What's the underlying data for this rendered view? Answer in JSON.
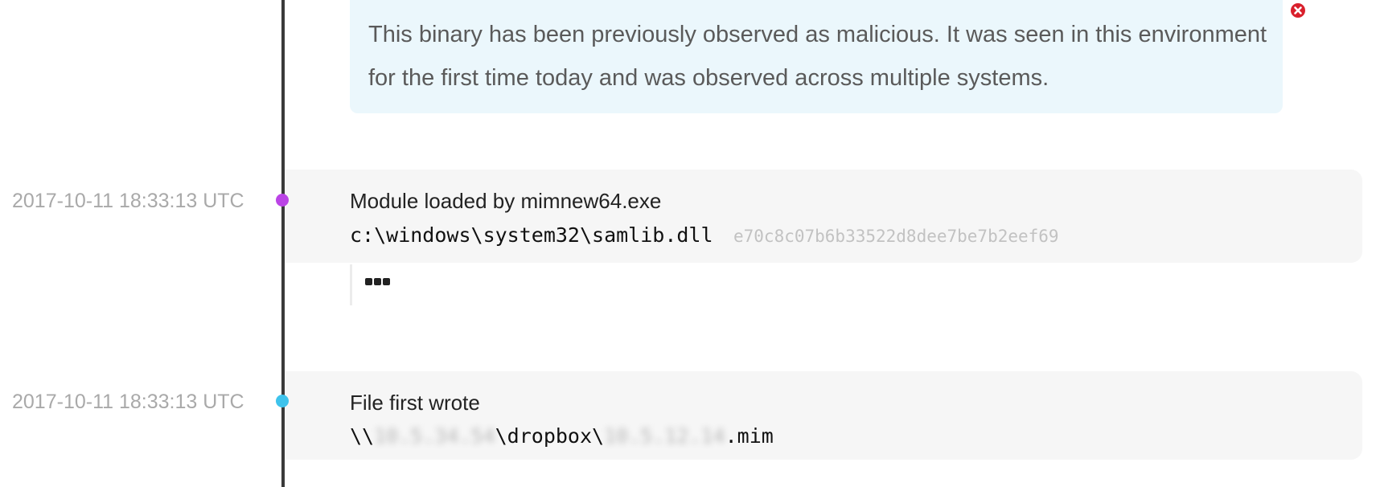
{
  "alert": {
    "message": "This binary has been previously observed as malicious. It was seen in this environment for the first time today and was observed across multiple systems.",
    "close_icon": "close-circle-icon",
    "close_color": "#d9202c"
  },
  "events": [
    {
      "timestamp": "2017-10-11 18:33:13 UTC",
      "dot_color": "#bb44e6",
      "title": "Module loaded by mimnew64.exe",
      "path": "c:\\windows\\system32\\samlib.dll",
      "hash": "e70c8c07b6b33522d8dee7be7b2eef69",
      "more_icon": "ellipsis-icon"
    },
    {
      "timestamp": "2017-10-11 18:33:13 UTC",
      "dot_color": "#3ec3ec",
      "title": "File first wrote",
      "path_prefix": "\\\\",
      "path_redacted_1": "10.5.34.54",
      "path_mid": "\\dropbox\\",
      "path_redacted_2": "10.5.12.14",
      "path_suffix": ".mim"
    }
  ]
}
